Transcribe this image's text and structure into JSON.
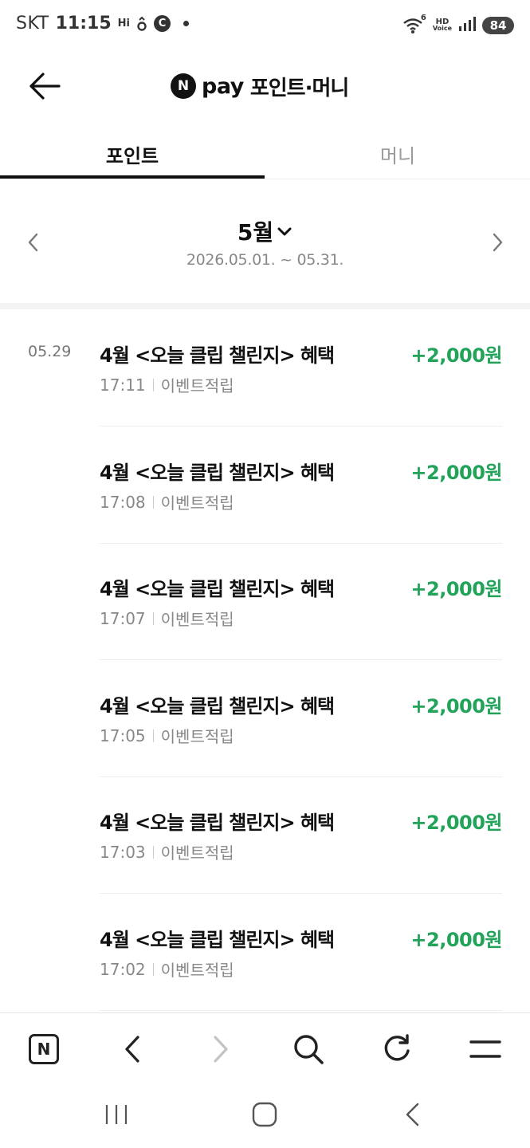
{
  "status_bar": {
    "carrier": "SKT",
    "time": "11:15",
    "hi_indicator": "Hi",
    "c_indicator": "C",
    "hd_label": "HD",
    "voice_label": "Voice",
    "battery": "84",
    "wifi_badge": "6",
    "icons": [
      "hi-icon",
      "loop-icon",
      "c-icon",
      "dot-icon",
      "wifi-icon",
      "hd-voice-icon",
      "signal-icon",
      "battery-icon"
    ]
  },
  "header": {
    "n_badge": "N",
    "pay_text": "pay",
    "title": "포인트·머니",
    "back_icon": "arrow-left-icon"
  },
  "tabs": [
    {
      "label": "포인트",
      "active": true
    },
    {
      "label": "머니",
      "active": false
    }
  ],
  "month_selector": {
    "month": "5월",
    "range": "2026.05.01. ~ 05.31.",
    "prev_icon": "chevron-left-icon",
    "next_icon": "chevron-right-icon",
    "dropdown_icon": "chevron-down-icon"
  },
  "history": {
    "date": "05.29",
    "items": [
      {
        "title": "4월 <오늘 클립 챌린지> 혜택",
        "amount": "+2,000원",
        "time": "17:11",
        "category": "이벤트적립"
      },
      {
        "title": "4월 <오늘 클립 챌린지> 혜택",
        "amount": "+2,000원",
        "time": "17:08",
        "category": "이벤트적립"
      },
      {
        "title": "4월 <오늘 클립 챌린지> 혜택",
        "amount": "+2,000원",
        "time": "17:07",
        "category": "이벤트적립"
      },
      {
        "title": "4월 <오늘 클립 챌린지> 혜택",
        "amount": "+2,000원",
        "time": "17:05",
        "category": "이벤트적립"
      },
      {
        "title": "4월 <오늘 클립 챌린지> 혜택",
        "amount": "+2,000원",
        "time": "17:03",
        "category": "이벤트적립"
      },
      {
        "title": "4월 <오늘 클립 챌린지> 혜택",
        "amount": "+2,000원",
        "time": "17:02",
        "category": "이벤트적립"
      }
    ]
  },
  "browser_toolbar": {
    "home_glyph": "N",
    "icons": [
      "naver-home-icon",
      "back-icon",
      "forward-icon",
      "search-icon",
      "refresh-icon",
      "menu-icon"
    ]
  },
  "system_nav": {
    "icons": [
      "recent-apps-icon",
      "home-icon",
      "back-icon"
    ]
  },
  "colors": {
    "amount_green": "#21a35a",
    "text_primary": "#111111",
    "text_secondary": "#888888"
  }
}
